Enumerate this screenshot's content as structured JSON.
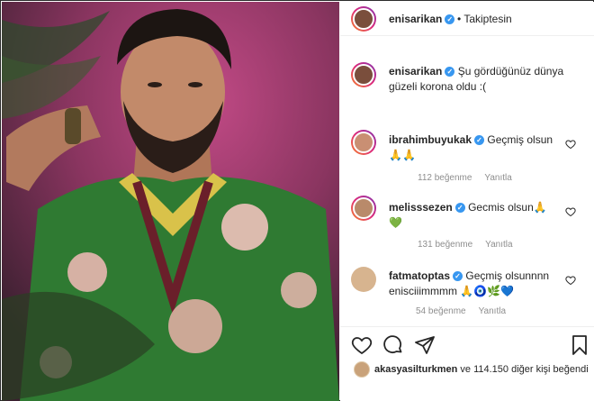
{
  "post": {
    "author": "enisarikan",
    "follow_status": "• Takiptesin",
    "caption": "Şu gördüğünüz dünya güzeli korona oldu :("
  },
  "comments": [
    {
      "user": "ibrahimbuyukak",
      "text": "Geçmiş olsun",
      "emoji": "🙏🙏",
      "likes": "112 beğenme",
      "reply": "Yanıtla"
    },
    {
      "user": "melisssezen",
      "text": "Gecmis olsun🙏",
      "emoji": "💚",
      "likes": "131 beğenme",
      "reply": "Yanıtla"
    },
    {
      "user": "fatmatoptas",
      "text": "Geçmiş olsunnnn enisciiimmmm",
      "emoji": "🙏🧿🌿💙",
      "likes": "54 beğenme",
      "reply": "Yanıtla"
    }
  ],
  "liked_by": {
    "user": "akasyasilturkmen",
    "rest": "ve 114.150 diğer kişi beğendi"
  },
  "colors": {
    "verified": "#3897f0",
    "meta": "#8e8e8e",
    "text": "#262626"
  },
  "icons": [
    "verified-icon",
    "heart-icon",
    "comment-icon",
    "share-icon",
    "bookmark-icon",
    "small-heart-icon"
  ]
}
